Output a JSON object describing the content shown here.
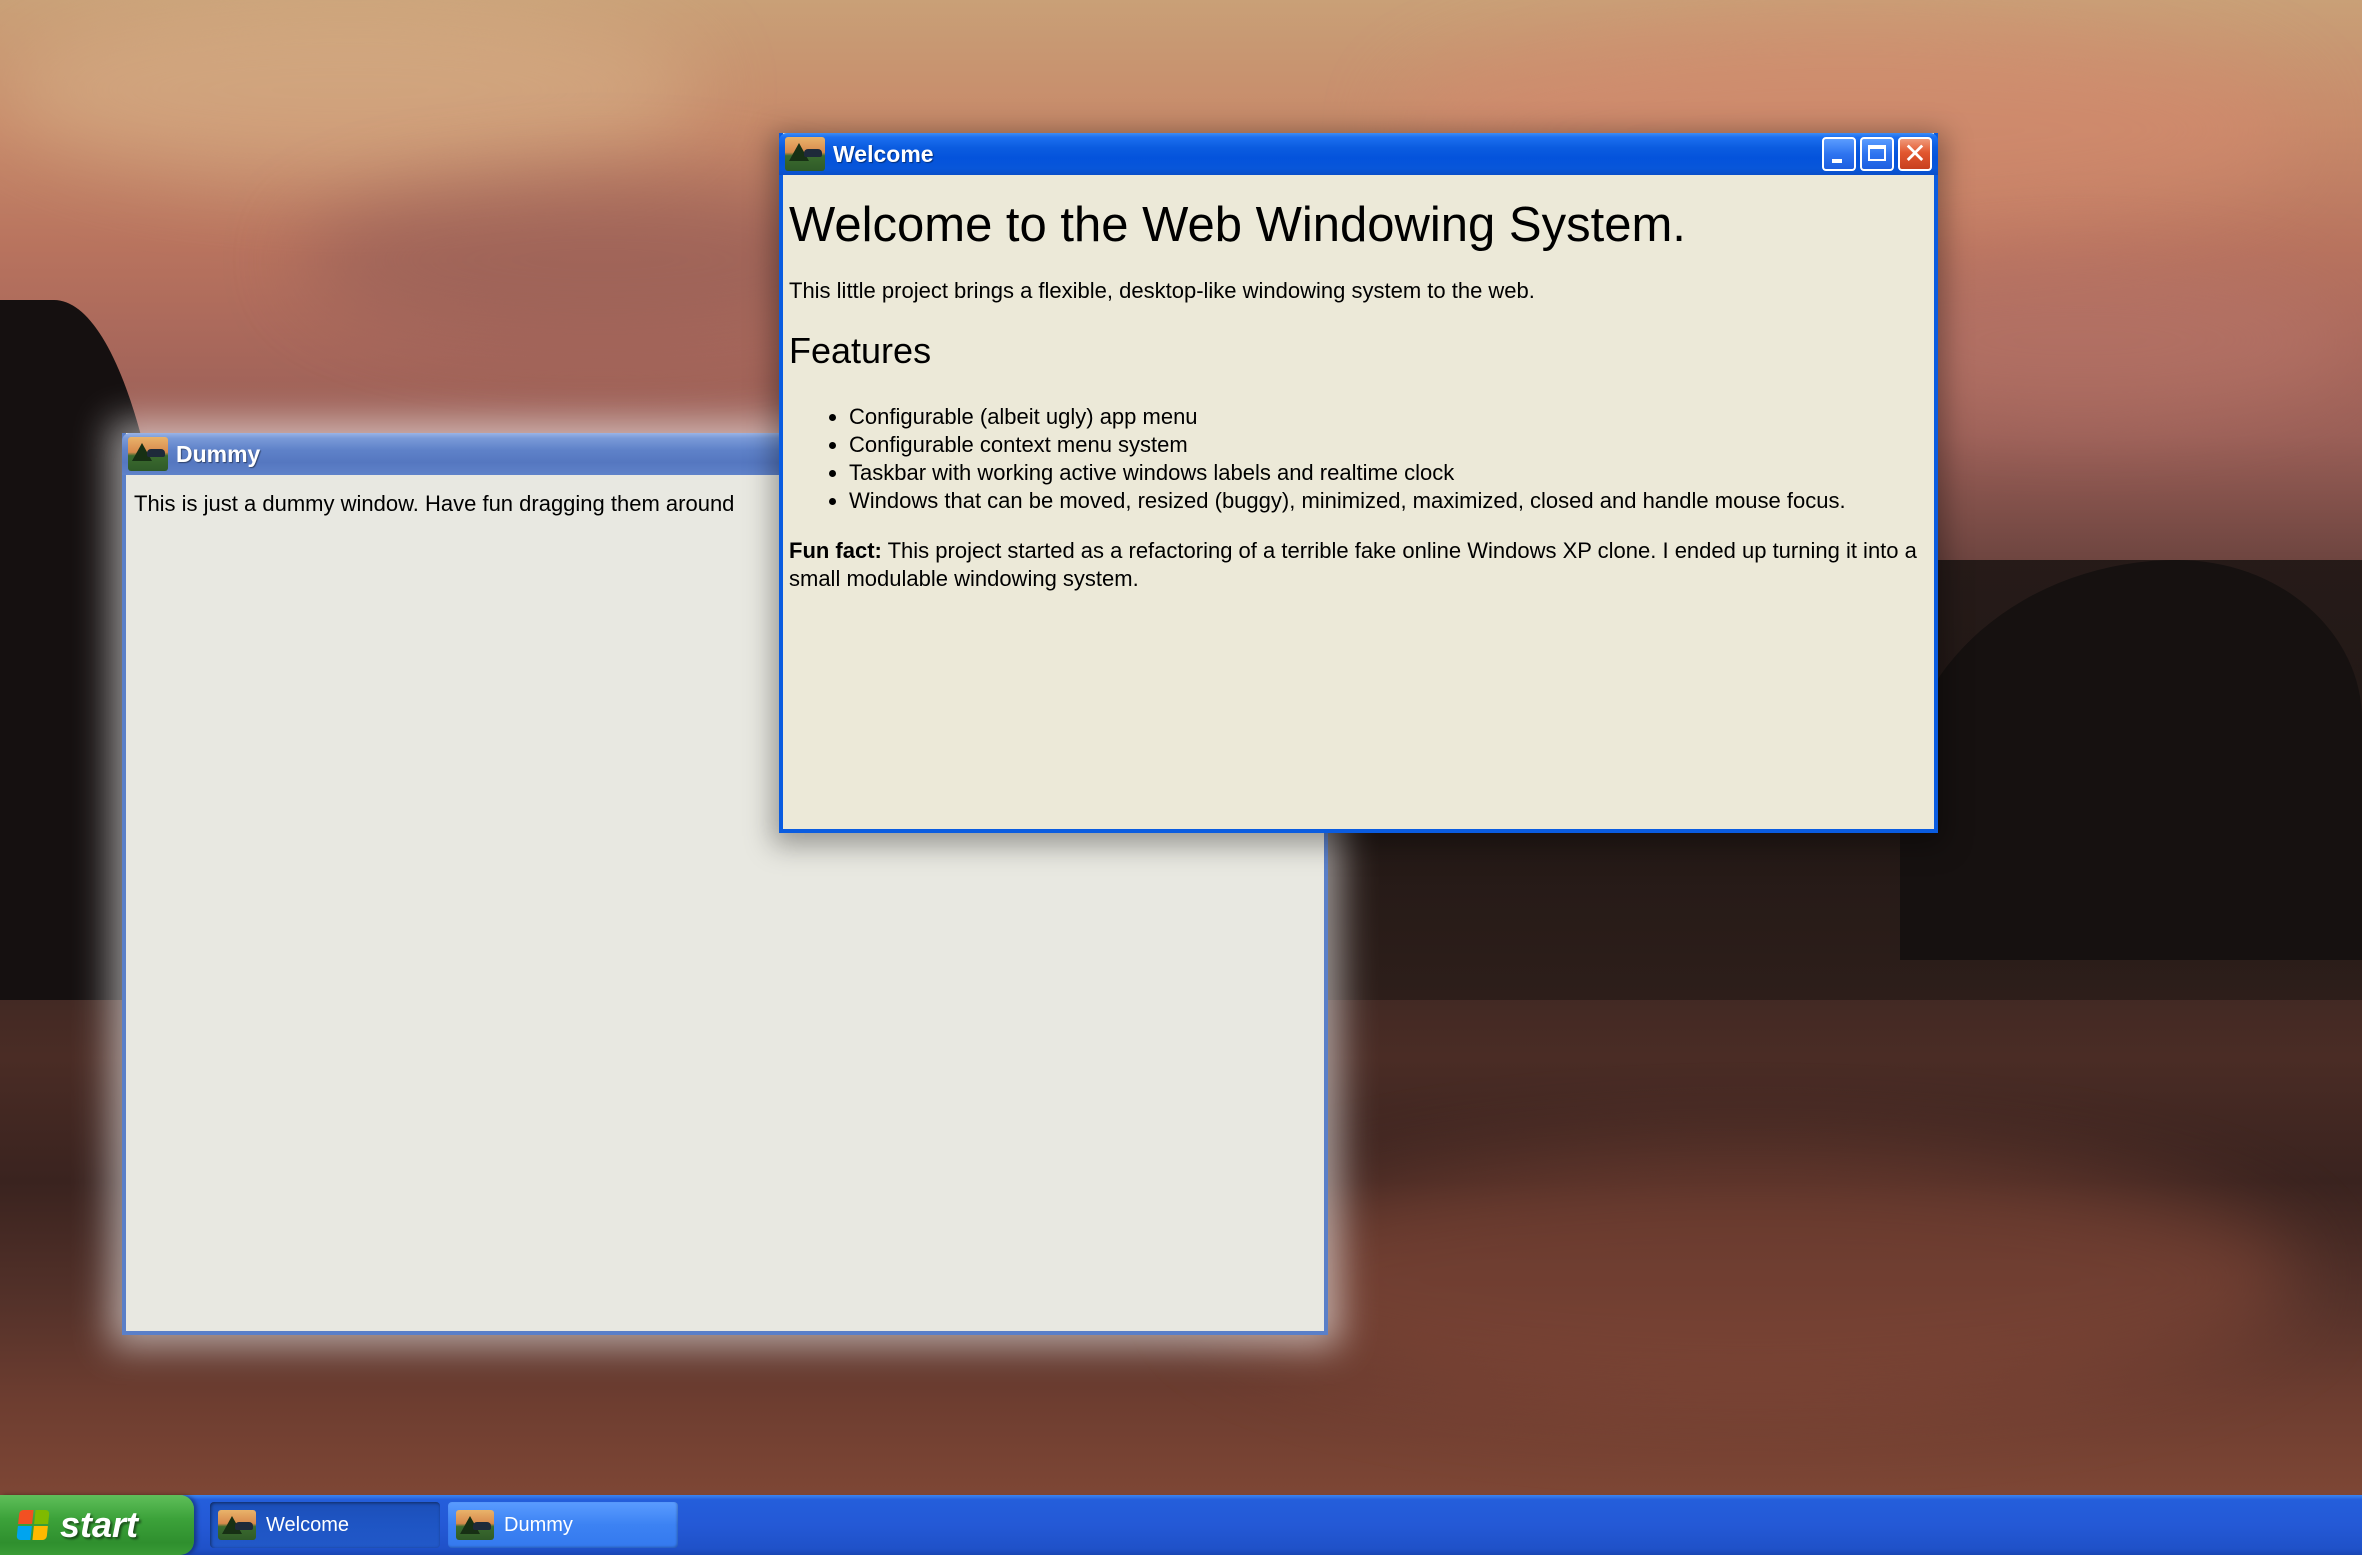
{
  "desktop": {
    "wallpaper": "sunset-lake"
  },
  "windows": {
    "welcome": {
      "title": "Welcome",
      "icon": "lake-scene-icon",
      "heading": "Welcome to the Web Windowing System.",
      "intro": "This little project brings a flexible, desktop-like windowing system to the web.",
      "features_heading": "Features",
      "features": [
        "Configurable (albeit ugly) app menu",
        "Configurable context menu system",
        "Taskbar with working active windows labels and realtime clock",
        "Windows that can be moved, resized (buggy), minimized, maximized, closed and handle mouse focus."
      ],
      "fun_fact_label": "Fun fact:",
      "fun_fact_text": " This project started as a refactoring of a terrible fake online Windows XP clone. I ended up turning it into a small modulable windowing system.",
      "buttons": {
        "minimize": "minimize-icon",
        "maximize": "maximize-icon",
        "close": "close-icon"
      }
    },
    "dummy": {
      "title": "Dummy",
      "icon": "lake-scene-icon",
      "body": "This is just a dummy window. Have fun dragging them around"
    }
  },
  "taskbar": {
    "start_label": "start",
    "tasks": [
      {
        "label": "Welcome",
        "active": true
      },
      {
        "label": "Dummy",
        "active": false
      }
    ]
  },
  "colors": {
    "active_titlebar": "#0a5ce0",
    "inactive_titlebar": "#5f82c9",
    "window_body": "#ece9d8",
    "taskbar": "#245edb",
    "start_button": "#3ca23a"
  }
}
